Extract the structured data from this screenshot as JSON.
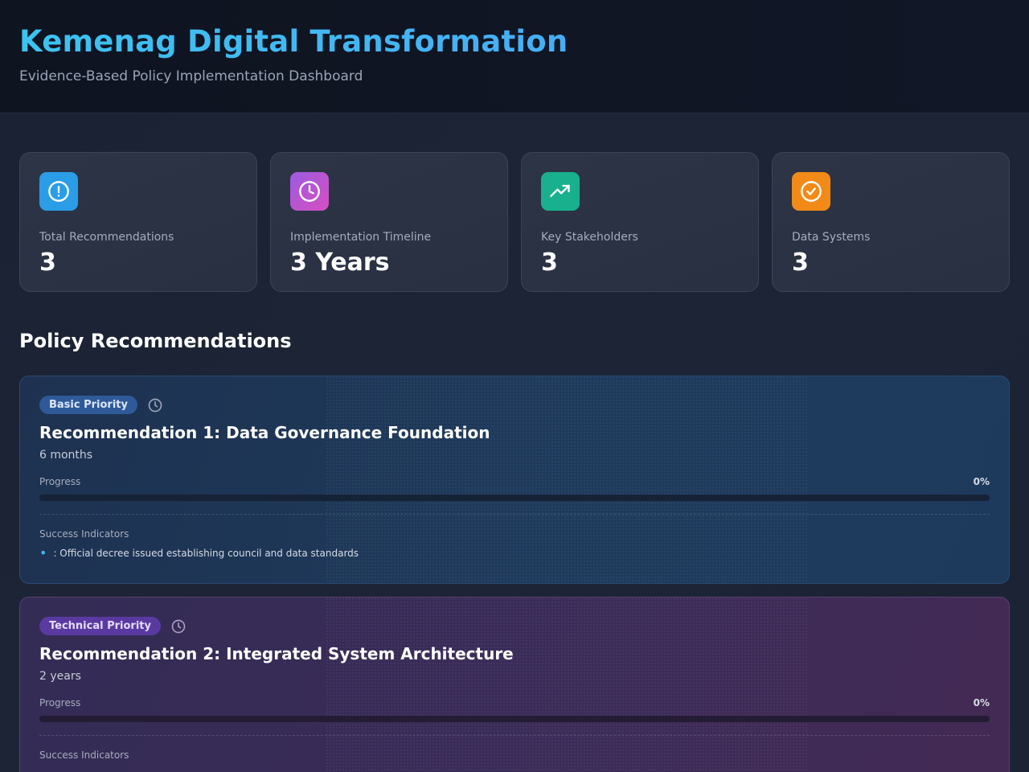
{
  "header": {
    "title": "Kemenag Digital Transformation",
    "subtitle": "Evidence-Based Policy Implementation Dashboard"
  },
  "stats": [
    {
      "icon": "alert-circle-icon",
      "color": "#2b9de6",
      "label": "Total Recommendations",
      "value": "3"
    },
    {
      "icon": "clock-icon",
      "color": "#c84fc9",
      "label": "Implementation Timeline",
      "value": "3 Years"
    },
    {
      "icon": "trending-up-icon",
      "color": "#19b08e",
      "label": "Key Stakeholders",
      "value": "3"
    },
    {
      "icon": "check-circle-icon",
      "color": "#f28a18",
      "label": "Data Systems",
      "value": "3"
    }
  ],
  "section": {
    "title": "Policy Recommendations"
  },
  "recommendations": [
    {
      "badge": "Basic Priority",
      "title": "Recommendation 1: Data Governance Foundation",
      "duration": "6 months",
      "progress_label": "Progress",
      "progress_text": "0%",
      "progress": 0,
      "indicators_title": "Success Indicators",
      "indicators": [
        ": Official decree issued establishing council and data standards"
      ]
    },
    {
      "badge": "Technical Priority",
      "title": "Recommendation 2: Integrated System Architecture",
      "duration": "2 years",
      "progress_label": "Progress",
      "progress_text": "0%",
      "progress": 0,
      "indicators_title": "Success Indicators",
      "indicators": []
    }
  ]
}
